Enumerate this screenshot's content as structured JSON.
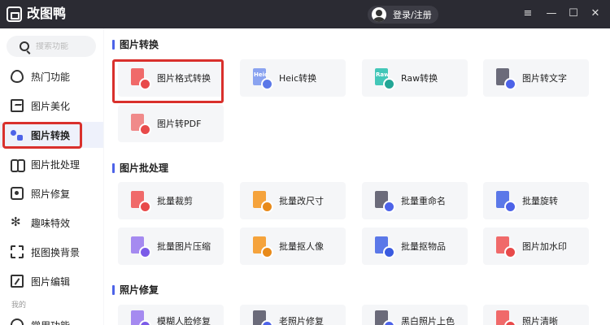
{
  "app": {
    "title": "改图鸭",
    "login": "登录/注册"
  },
  "window_controls": {
    "menu": "≡",
    "minimize": "—",
    "maximize": "☐",
    "close": "✕"
  },
  "sidebar": {
    "search_placeholder": "搜索功能",
    "items": [
      {
        "label": "热门功能",
        "icon": "fire-icon"
      },
      {
        "label": "图片美化",
        "icon": "image-icon"
      },
      {
        "label": "图片转换",
        "icon": "convert-icon"
      },
      {
        "label": "图片批处理",
        "icon": "batch-icon"
      },
      {
        "label": "照片修复",
        "icon": "repair-icon"
      },
      {
        "label": "趣味特效",
        "icon": "sparkle-icon"
      },
      {
        "label": "抠图换背景",
        "icon": "cutout-icon"
      },
      {
        "label": "图片编辑",
        "icon": "edit-icon"
      },
      {
        "label": "常用功能",
        "icon": "common-icon"
      }
    ],
    "active_index": 2,
    "group_label": "我的"
  },
  "sections": [
    {
      "title": "图片转换",
      "cards": [
        {
          "label": "图片格式转换",
          "tag": "",
          "c1": "#f06a6a",
          "c2": "#e84a4a"
        },
        {
          "label": "Heic转换",
          "tag": "Heic",
          "c1": "#8aa3f0",
          "c2": "#5b78e8"
        },
        {
          "label": "Raw转换",
          "tag": "Raw",
          "c1": "#43c7b8",
          "c2": "#23a696"
        },
        {
          "label": "图片转文字",
          "tag": "",
          "c1": "#6b6b7a",
          "c2": "#4d63e8"
        },
        {
          "label": "图片转PDF",
          "tag": "",
          "c1": "#f08a8a",
          "c2": "#e84a4a"
        }
      ]
    },
    {
      "title": "图片批处理",
      "cards": [
        {
          "label": "批量裁剪",
          "tag": "",
          "c1": "#f06a6a",
          "c2": "#e84a4a"
        },
        {
          "label": "批量改尺寸",
          "tag": "",
          "c1": "#f5a33c",
          "c2": "#e88a1a"
        },
        {
          "label": "批量重命名",
          "tag": "",
          "c1": "#6b6b7a",
          "c2": "#4d63e8"
        },
        {
          "label": "批量旋转",
          "tag": "",
          "c1": "#5b78e8",
          "c2": "#4d63e8"
        },
        {
          "label": "批量图片压缩",
          "tag": "",
          "c1": "#a58af0",
          "c2": "#7b5be8"
        },
        {
          "label": "批量抠人像",
          "tag": "",
          "c1": "#f5a33c",
          "c2": "#e88a1a"
        },
        {
          "label": "批量抠物品",
          "tag": "",
          "c1": "#5b78e8",
          "c2": "#3a5be0"
        },
        {
          "label": "图片加水印",
          "tag": "",
          "c1": "#f06a6a",
          "c2": "#e84a4a"
        }
      ]
    },
    {
      "title": "照片修复",
      "cards": [
        {
          "label": "模糊人脸修复",
          "tag": "",
          "c1": "#a58af0",
          "c2": "#7b5be8"
        },
        {
          "label": "老照片修复",
          "tag": "",
          "c1": "#6b6b7a",
          "c2": "#4d63e8"
        },
        {
          "label": "黑白照片上色",
          "tag": "",
          "c1": "#6b6b7a",
          "c2": "#4d63e8"
        },
        {
          "label": "照片清晰",
          "tag": "",
          "c1": "#f06a6a",
          "c2": "#e84a4a"
        }
      ]
    }
  ]
}
